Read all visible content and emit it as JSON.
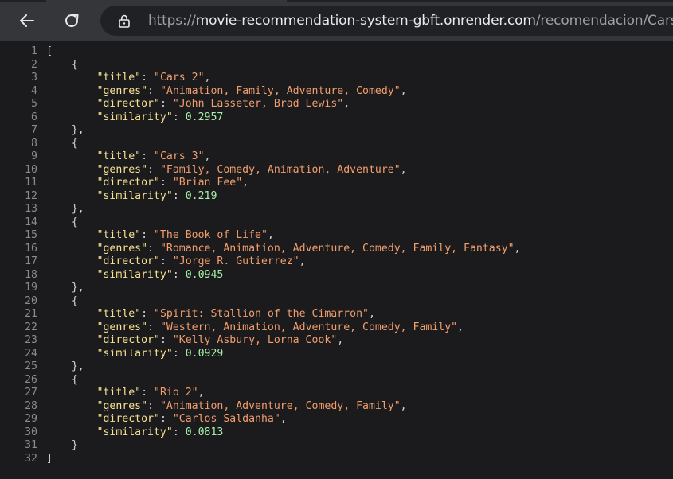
{
  "browser": {
    "url_scheme": "https://",
    "url_host": "movie-recommendation-system-gbft.onrender.com",
    "url_path": "/recomendacion/Cars",
    "back_icon": "arrow-left-icon",
    "reload_icon": "reload-icon",
    "lock_icon": "lock-icon"
  },
  "json_lines": [
    {
      "n": "1",
      "parts": [
        {
          "t": "[",
          "c": "punct"
        }
      ]
    },
    {
      "n": "2",
      "parts": [
        {
          "t": "    {",
          "c": "punct"
        }
      ]
    },
    {
      "n": "3",
      "parts": [
        {
          "t": "        ",
          "c": "punct"
        },
        {
          "t": "\"title\"",
          "c": "key"
        },
        {
          "t": ": ",
          "c": "punct"
        },
        {
          "t": "\"Cars 2\"",
          "c": "str"
        },
        {
          "t": ",",
          "c": "punct"
        }
      ]
    },
    {
      "n": "4",
      "parts": [
        {
          "t": "        ",
          "c": "punct"
        },
        {
          "t": "\"genres\"",
          "c": "key"
        },
        {
          "t": ": ",
          "c": "punct"
        },
        {
          "t": "\"Animation, Family, Adventure, Comedy\"",
          "c": "str"
        },
        {
          "t": ",",
          "c": "punct"
        }
      ]
    },
    {
      "n": "5",
      "parts": [
        {
          "t": "        ",
          "c": "punct"
        },
        {
          "t": "\"director\"",
          "c": "key"
        },
        {
          "t": ": ",
          "c": "punct"
        },
        {
          "t": "\"John Lasseter, Brad Lewis\"",
          "c": "str"
        },
        {
          "t": ",",
          "c": "punct"
        }
      ]
    },
    {
      "n": "6",
      "parts": [
        {
          "t": "        ",
          "c": "punct"
        },
        {
          "t": "\"similarity\"",
          "c": "key"
        },
        {
          "t": ": ",
          "c": "punct"
        },
        {
          "t": "0.2957",
          "c": "num"
        }
      ]
    },
    {
      "n": "7",
      "parts": [
        {
          "t": "    },",
          "c": "punct"
        }
      ]
    },
    {
      "n": "8",
      "parts": [
        {
          "t": "    {",
          "c": "punct"
        }
      ]
    },
    {
      "n": "9",
      "parts": [
        {
          "t": "        ",
          "c": "punct"
        },
        {
          "t": "\"title\"",
          "c": "key"
        },
        {
          "t": ": ",
          "c": "punct"
        },
        {
          "t": "\"Cars 3\"",
          "c": "str"
        },
        {
          "t": ",",
          "c": "punct"
        }
      ]
    },
    {
      "n": "10",
      "parts": [
        {
          "t": "        ",
          "c": "punct"
        },
        {
          "t": "\"genres\"",
          "c": "key"
        },
        {
          "t": ": ",
          "c": "punct"
        },
        {
          "t": "\"Family, Comedy, Animation, Adventure\"",
          "c": "str"
        },
        {
          "t": ",",
          "c": "punct"
        }
      ]
    },
    {
      "n": "11",
      "parts": [
        {
          "t": "        ",
          "c": "punct"
        },
        {
          "t": "\"director\"",
          "c": "key"
        },
        {
          "t": ": ",
          "c": "punct"
        },
        {
          "t": "\"Brian Fee\"",
          "c": "str"
        },
        {
          "t": ",",
          "c": "punct"
        }
      ]
    },
    {
      "n": "12",
      "parts": [
        {
          "t": "        ",
          "c": "punct"
        },
        {
          "t": "\"similarity\"",
          "c": "key"
        },
        {
          "t": ": ",
          "c": "punct"
        },
        {
          "t": "0.219",
          "c": "num"
        }
      ]
    },
    {
      "n": "13",
      "parts": [
        {
          "t": "    },",
          "c": "punct"
        }
      ]
    },
    {
      "n": "14",
      "parts": [
        {
          "t": "    {",
          "c": "punct"
        }
      ]
    },
    {
      "n": "15",
      "parts": [
        {
          "t": "        ",
          "c": "punct"
        },
        {
          "t": "\"title\"",
          "c": "key"
        },
        {
          "t": ": ",
          "c": "punct"
        },
        {
          "t": "\"The Book of Life\"",
          "c": "str"
        },
        {
          "t": ",",
          "c": "punct"
        }
      ]
    },
    {
      "n": "16",
      "parts": [
        {
          "t": "        ",
          "c": "punct"
        },
        {
          "t": "\"genres\"",
          "c": "key"
        },
        {
          "t": ": ",
          "c": "punct"
        },
        {
          "t": "\"Romance, Animation, Adventure, Comedy, Family, Fantasy\"",
          "c": "str"
        },
        {
          "t": ",",
          "c": "punct"
        }
      ]
    },
    {
      "n": "17",
      "parts": [
        {
          "t": "        ",
          "c": "punct"
        },
        {
          "t": "\"director\"",
          "c": "key"
        },
        {
          "t": ": ",
          "c": "punct"
        },
        {
          "t": "\"Jorge R. Gutierrez\"",
          "c": "str"
        },
        {
          "t": ",",
          "c": "punct"
        }
      ]
    },
    {
      "n": "18",
      "parts": [
        {
          "t": "        ",
          "c": "punct"
        },
        {
          "t": "\"similarity\"",
          "c": "key"
        },
        {
          "t": ": ",
          "c": "punct"
        },
        {
          "t": "0.0945",
          "c": "num"
        }
      ]
    },
    {
      "n": "19",
      "parts": [
        {
          "t": "    },",
          "c": "punct"
        }
      ]
    },
    {
      "n": "20",
      "parts": [
        {
          "t": "    {",
          "c": "punct"
        }
      ]
    },
    {
      "n": "21",
      "parts": [
        {
          "t": "        ",
          "c": "punct"
        },
        {
          "t": "\"title\"",
          "c": "key"
        },
        {
          "t": ": ",
          "c": "punct"
        },
        {
          "t": "\"Spirit: Stallion of the Cimarron\"",
          "c": "str"
        },
        {
          "t": ",",
          "c": "punct"
        }
      ]
    },
    {
      "n": "22",
      "parts": [
        {
          "t": "        ",
          "c": "punct"
        },
        {
          "t": "\"genres\"",
          "c": "key"
        },
        {
          "t": ": ",
          "c": "punct"
        },
        {
          "t": "\"Western, Animation, Adventure, Comedy, Family\"",
          "c": "str"
        },
        {
          "t": ",",
          "c": "punct"
        }
      ]
    },
    {
      "n": "23",
      "parts": [
        {
          "t": "        ",
          "c": "punct"
        },
        {
          "t": "\"director\"",
          "c": "key"
        },
        {
          "t": ": ",
          "c": "punct"
        },
        {
          "t": "\"Kelly Asbury, Lorna Cook\"",
          "c": "str"
        },
        {
          "t": ",",
          "c": "punct"
        }
      ]
    },
    {
      "n": "24",
      "parts": [
        {
          "t": "        ",
          "c": "punct"
        },
        {
          "t": "\"similarity\"",
          "c": "key"
        },
        {
          "t": ": ",
          "c": "punct"
        },
        {
          "t": "0.0929",
          "c": "num"
        }
      ]
    },
    {
      "n": "25",
      "parts": [
        {
          "t": "    },",
          "c": "punct"
        }
      ]
    },
    {
      "n": "26",
      "parts": [
        {
          "t": "    {",
          "c": "punct"
        }
      ]
    },
    {
      "n": "27",
      "parts": [
        {
          "t": "        ",
          "c": "punct"
        },
        {
          "t": "\"title\"",
          "c": "key"
        },
        {
          "t": ": ",
          "c": "punct"
        },
        {
          "t": "\"Rio 2\"",
          "c": "str"
        },
        {
          "t": ",",
          "c": "punct"
        }
      ]
    },
    {
      "n": "28",
      "parts": [
        {
          "t": "        ",
          "c": "punct"
        },
        {
          "t": "\"genres\"",
          "c": "key"
        },
        {
          "t": ": ",
          "c": "punct"
        },
        {
          "t": "\"Animation, Adventure, Comedy, Family\"",
          "c": "str"
        },
        {
          "t": ",",
          "c": "punct"
        }
      ]
    },
    {
      "n": "29",
      "parts": [
        {
          "t": "        ",
          "c": "punct"
        },
        {
          "t": "\"director\"",
          "c": "key"
        },
        {
          "t": ": ",
          "c": "punct"
        },
        {
          "t": "\"Carlos Saldanha\"",
          "c": "str"
        },
        {
          "t": ",",
          "c": "punct"
        }
      ]
    },
    {
      "n": "30",
      "parts": [
        {
          "t": "        ",
          "c": "punct"
        },
        {
          "t": "\"similarity\"",
          "c": "key"
        },
        {
          "t": ": ",
          "c": "punct"
        },
        {
          "t": "0.0813",
          "c": "num"
        }
      ]
    },
    {
      "n": "31",
      "parts": [
        {
          "t": "    }",
          "c": "punct"
        }
      ]
    },
    {
      "n": "32",
      "parts": [
        {
          "t": "]",
          "c": "punct"
        }
      ]
    }
  ],
  "colors": {
    "toolbar_bg": "#35363a",
    "omnibox_bg": "#202124",
    "viewer_bg": "#1b1b1d",
    "key": "#f7e291",
    "string": "#f29e6d",
    "number": "#a8f0a8",
    "punctuation": "#d4d4d4",
    "line_number": "#8b8b8b"
  }
}
